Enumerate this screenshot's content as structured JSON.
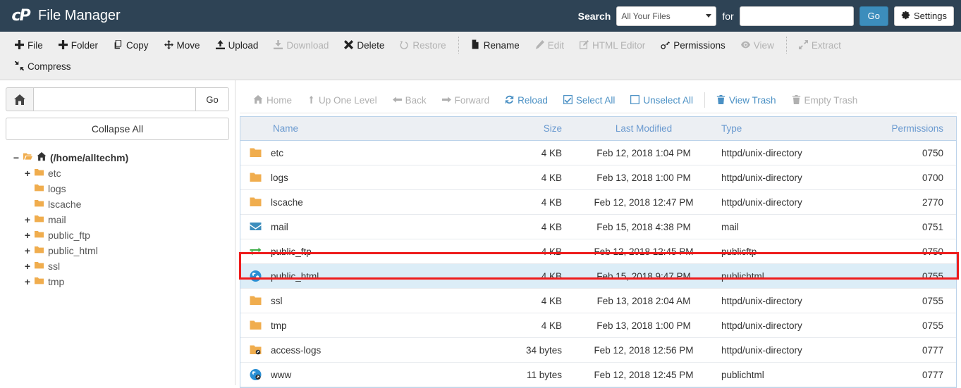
{
  "header": {
    "app_title": "File Manager",
    "logo_text": "cP",
    "search_label": "Search",
    "search_scope": "All Your Files",
    "for_label": "for",
    "search_value": "",
    "search_placeholder": "",
    "go_label": "Go",
    "settings_label": "Settings"
  },
  "toolbar": {
    "row1": [
      {
        "label": "File",
        "icon": "plus-icon",
        "disabled": false
      },
      {
        "label": "Folder",
        "icon": "plus-icon",
        "disabled": false
      },
      {
        "label": "Copy",
        "icon": "copy-icon",
        "disabled": false
      },
      {
        "label": "Move",
        "icon": "move-icon",
        "disabled": false
      },
      {
        "label": "Upload",
        "icon": "upload-icon",
        "disabled": false
      },
      {
        "label": "Download",
        "icon": "download-icon",
        "disabled": true
      },
      {
        "label": "Delete",
        "icon": "times-icon",
        "disabled": false
      },
      {
        "label": "Restore",
        "icon": "undo-icon",
        "disabled": true
      },
      {
        "label": "Rename",
        "icon": "file-icon",
        "disabled": false
      },
      {
        "label": "Edit",
        "icon": "pencil-icon",
        "disabled": true
      },
      {
        "label": "HTML Editor",
        "icon": "edit-square-icon",
        "disabled": true
      },
      {
        "label": "Permissions",
        "icon": "key-icon",
        "disabled": false
      },
      {
        "label": "View",
        "icon": "eye-icon",
        "disabled": true
      },
      {
        "label": "Extract",
        "icon": "expand-icon",
        "disabled": true
      }
    ],
    "row2": [
      {
        "label": "Compress",
        "icon": "compress-icon",
        "disabled": false
      }
    ]
  },
  "sidebar": {
    "path_value": "",
    "path_placeholder": "",
    "go_label": "Go",
    "collapse_label": "Collapse All",
    "tree": [
      {
        "label": "(/home/alltechm)",
        "expander": "−",
        "depth": 0,
        "root": true
      },
      {
        "label": "etc",
        "expander": "+",
        "depth": 1,
        "root": false
      },
      {
        "label": "logs",
        "expander": "",
        "depth": 1,
        "root": false
      },
      {
        "label": "lscache",
        "expander": "",
        "depth": 1,
        "root": false
      },
      {
        "label": "mail",
        "expander": "+",
        "depth": 1,
        "root": false
      },
      {
        "label": "public_ftp",
        "expander": "+",
        "depth": 1,
        "root": false
      },
      {
        "label": "public_html",
        "expander": "+",
        "depth": 1,
        "root": false
      },
      {
        "label": "ssl",
        "expander": "+",
        "depth": 1,
        "root": false
      },
      {
        "label": "tmp",
        "expander": "+",
        "depth": 1,
        "root": false
      }
    ]
  },
  "navbar": [
    {
      "label": "Home",
      "icon": "home-icon",
      "disabled": true
    },
    {
      "label": "Up One Level",
      "icon": "up-arrow-icon",
      "disabled": true
    },
    {
      "label": "Back",
      "icon": "left-arrow-icon",
      "disabled": true
    },
    {
      "label": "Forward",
      "icon": "right-arrow-icon",
      "disabled": true
    },
    {
      "label": "Reload",
      "icon": "reload-icon",
      "disabled": false
    },
    {
      "label": "Select All",
      "icon": "checked-box-icon",
      "disabled": false
    },
    {
      "label": "Unselect All",
      "icon": "empty-box-icon",
      "disabled": false
    },
    {
      "divider": true
    },
    {
      "label": "View Trash",
      "icon": "trash-icon",
      "disabled": false
    },
    {
      "label": "Empty Trash",
      "icon": "trash-icon",
      "disabled": true
    }
  ],
  "table": {
    "columns": [
      "Name",
      "Size",
      "Last Modified",
      "Type",
      "Permissions"
    ],
    "rows": [
      {
        "name": "etc",
        "size": "4 KB",
        "modified": "Feb 12, 2018 1:04 PM",
        "type": "httpd/unix-directory",
        "permissions": "0750",
        "icon": "folder-icon",
        "selected": false
      },
      {
        "name": "logs",
        "size": "4 KB",
        "modified": "Feb 13, 2018 1:00 PM",
        "type": "httpd/unix-directory",
        "permissions": "0700",
        "icon": "folder-icon",
        "selected": false
      },
      {
        "name": "lscache",
        "size": "4 KB",
        "modified": "Feb 12, 2018 12:47 PM",
        "type": "httpd/unix-directory",
        "permissions": "2770",
        "icon": "folder-icon",
        "selected": false
      },
      {
        "name": "mail",
        "size": "4 KB",
        "modified": "Feb 15, 2018 4:38 PM",
        "type": "mail",
        "permissions": "0751",
        "icon": "mail-icon",
        "selected": false
      },
      {
        "name": "public_ftp",
        "size": "4 KB",
        "modified": "Feb 12, 2018 12:45 PM",
        "type": "publicftp",
        "permissions": "0750",
        "icon": "ftp-exchange-icon",
        "selected": false
      },
      {
        "name": "public_html",
        "size": "4 KB",
        "modified": "Feb 15, 2018 9:47 PM",
        "type": "publichtml",
        "permissions": "0755",
        "icon": "globe-icon",
        "selected": true
      },
      {
        "name": "ssl",
        "size": "4 KB",
        "modified": "Feb 13, 2018 2:04 AM",
        "type": "httpd/unix-directory",
        "permissions": "0755",
        "icon": "folder-icon",
        "selected": false
      },
      {
        "name": "tmp",
        "size": "4 KB",
        "modified": "Feb 13, 2018 1:00 PM",
        "type": "httpd/unix-directory",
        "permissions": "0755",
        "icon": "folder-icon",
        "selected": false
      },
      {
        "name": "access-logs",
        "size": "34 bytes",
        "modified": "Feb 12, 2018 12:56 PM",
        "type": "httpd/unix-directory",
        "permissions": "0777",
        "icon": "folder-shortcut-icon",
        "selected": false
      },
      {
        "name": "www",
        "size": "11 bytes",
        "modified": "Feb 12, 2018 12:45 PM",
        "type": "publichtml",
        "permissions": "0777",
        "icon": "globe-shortcut-icon",
        "selected": false
      }
    ]
  },
  "colors": {
    "header_bg": "#2e4355",
    "accent_blue": "#3c8dbc",
    "link_blue": "#4a90c4",
    "folder_orange": "#f0ad4e",
    "selection_bg": "#dcedf7",
    "annotation_red": "#ee1c1c"
  }
}
